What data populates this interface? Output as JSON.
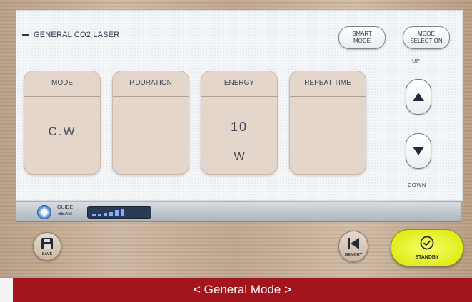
{
  "header": {
    "title": "GENERAL CO2 LASER"
  },
  "buttons": {
    "smart_mode": [
      "SMART",
      "MODE"
    ],
    "mode_selection": [
      "MODE",
      "SELECTION"
    ],
    "up_label": "UP",
    "down_label": "DOWN",
    "save_label": "SAVE",
    "memory_label": "MEMORY",
    "standby_label": "STANDBY"
  },
  "panels": [
    {
      "label": "MODE",
      "value": "C.W",
      "unit": ""
    },
    {
      "label": "P.DURATION",
      "value": "",
      "unit": ""
    },
    {
      "label": "ENERGY",
      "value": "10",
      "unit": "W"
    },
    {
      "label": "REPEAT TIME",
      "value": "",
      "unit": ""
    }
  ],
  "status": {
    "guide_beam": [
      "GUIDE",
      "BEAM"
    ],
    "guide_beam_level": 6
  },
  "footer": {
    "caption": "< General Mode >"
  },
  "colors": {
    "banner": "#a3151d",
    "standby": "#e2ef12",
    "panel": "#e4d6ca",
    "accent_blue": "#3a6fb5"
  }
}
